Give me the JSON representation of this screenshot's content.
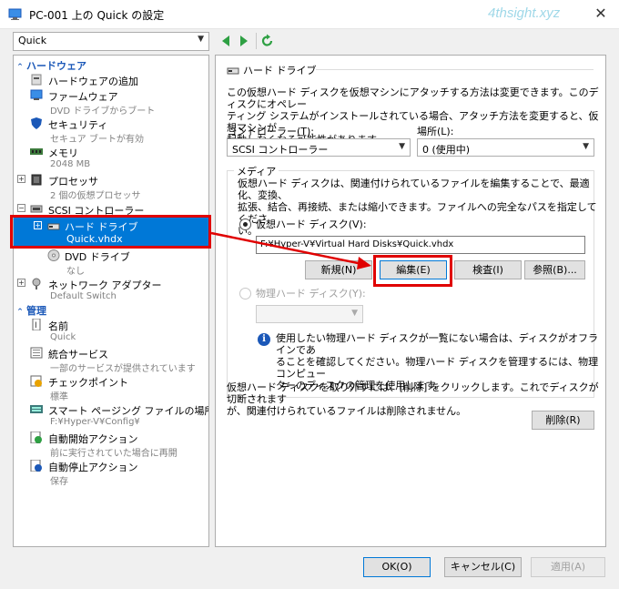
{
  "window": {
    "title": "PC-001 上の Quick の設定",
    "watermark": "4thsight.xyz",
    "close_glyph": "✕"
  },
  "toolbar": {
    "vm_selected": "Quick"
  },
  "sidebar": {
    "hardware_header": "ハードウェア",
    "management_header": "管理",
    "hardware_items": [
      {
        "label": "ハードウェアの追加",
        "sub": ""
      },
      {
        "label": "ファームウェア",
        "sub": "DVD ドライブからブート"
      },
      {
        "label": "セキュリティ",
        "sub": "セキュア ブートが有効"
      },
      {
        "label": "メモリ",
        "sub": "2048 MB"
      },
      {
        "label": "プロセッサ",
        "sub": "2 個の仮想プロセッサ"
      },
      {
        "label": "SCSI コントローラー",
        "sub": ""
      },
      {
        "label": "ハード ドライブ",
        "sub": "Quick.vhdx"
      },
      {
        "label": "DVD ドライブ",
        "sub": "なし"
      },
      {
        "label": "ネットワーク アダプター",
        "sub": "Default Switch"
      }
    ],
    "management_items": [
      {
        "label": "名前",
        "sub": "Quick"
      },
      {
        "label": "統合サービス",
        "sub": "一部のサービスが提供されています"
      },
      {
        "label": "チェックポイント",
        "sub": "標準"
      },
      {
        "label": "スマート ページング ファイルの場所",
        "sub": "F:¥Hyper-V¥Config¥"
      },
      {
        "label": "自動開始アクション",
        "sub": "前に実行されていた場合に再開"
      },
      {
        "label": "自動停止アクション",
        "sub": "保存"
      }
    ]
  },
  "main": {
    "group_title": "ハード ドライブ",
    "description": [
      "この仮想ハード ディスクを仮想マシンにアタッチする方法は変更できます。このディスクにオペレー",
      "ティング システムがインストールされている場合、アタッチ方法を変更すると、仮想マシンが",
      "起動しなくなる可能性があります。"
    ],
    "controller_label": "コントローラー(T):",
    "controller_value": "SCSI コントローラー",
    "location_label": "場所(L):",
    "location_value": "0 (使用中)",
    "media_label": "メディア",
    "media_description": [
      "仮想ハード ディスクは、関連付けられているファイルを編集することで、最適化、変換、",
      "拡張、結合、再接続、または縮小できます。ファイルへの完全なパスを指定してくださ",
      "い。"
    ],
    "virtual_disk_label": "仮想ハード ディスク(V):",
    "virtual_disk_path": "F:¥Hyper-V¥Virtual Hard Disks¥Quick.vhdx",
    "buttons": {
      "new": "新規(N)",
      "edit": "編集(E)",
      "inspect": "検査(I)",
      "browse": "参照(B)..."
    },
    "physical_disk_label": "物理ハード ディスク(Y):",
    "physical_info": [
      "使用したい物理ハード ディスクが一覧にない場合は、ディスクがオフラインであ",
      "ることを確認してください。物理ハード ディスクを管理するには、物理コンピュー",
      "ターのディスクの管理を使用します。"
    ],
    "remove_description": [
      "仮想ハード ディスクを取り外すには、[削除] をクリックします。これでディスクが切断されます",
      "が、関連付けられているファイルは削除されません。"
    ],
    "remove_button": "削除(R)"
  },
  "footer": {
    "ok": "OK(O)",
    "cancel": "キャンセル(C)",
    "apply": "適用(A)"
  }
}
